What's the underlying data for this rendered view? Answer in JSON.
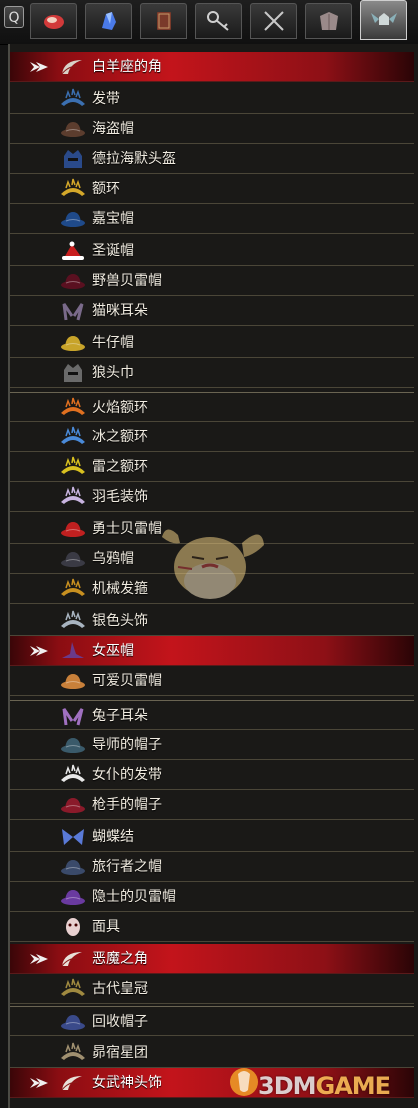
{
  "search": {
    "label": "Q"
  },
  "tabs": [
    {
      "name": "tab-food",
      "icon": "meat-icon"
    },
    {
      "name": "tab-materials",
      "icon": "crystal-icon"
    },
    {
      "name": "tab-books",
      "icon": "book-icon"
    },
    {
      "name": "tab-keys",
      "icon": "key-icon"
    },
    {
      "name": "tab-weapons",
      "icon": "crossed-swords-icon"
    },
    {
      "name": "tab-armor",
      "icon": "armor-icon"
    },
    {
      "name": "tab-accessories",
      "icon": "winged-helmet-icon",
      "active": true
    }
  ],
  "items": [
    {
      "label": "白羊座的角",
      "selected": true,
      "icon": "horn-icon",
      "color": "#d8d2c8"
    },
    {
      "label": "发带",
      "icon": "headband-icon",
      "color": "#3b6fb0"
    },
    {
      "label": "海盗帽",
      "icon": "pirate-hat-icon",
      "color": "#5c3d2e"
    },
    {
      "label": "德拉海默头盔",
      "icon": "helmet-icon",
      "color": "#2a4a8a"
    },
    {
      "label": "额环",
      "icon": "circlet-icon",
      "color": "#d4a82a"
    },
    {
      "label": "嘉宝帽",
      "icon": "cap-icon",
      "color": "#1f4a8a"
    },
    {
      "label": "圣诞帽",
      "icon": "santa-hat-icon",
      "color": "#c81e1e"
    },
    {
      "label": "野兽贝雷帽",
      "icon": "beret-icon",
      "color": "#5a1020"
    },
    {
      "label": "猫咪耳朵",
      "icon": "cat-ears-icon",
      "color": "#7a6a8a"
    },
    {
      "label": "牛仔帽",
      "icon": "cowboy-hat-icon",
      "color": "#c8a42a"
    },
    {
      "label": "狼头巾",
      "icon": "wolf-hood-icon",
      "color": "#6a6a6a"
    },
    {
      "label": "火焰额环",
      "icon": "flame-circlet-icon",
      "color": "#e07020"
    },
    {
      "label": "冰之额环",
      "icon": "ice-circlet-icon",
      "color": "#4a8ad8"
    },
    {
      "label": "雷之额环",
      "icon": "thunder-circlet-icon",
      "color": "#d8c020"
    },
    {
      "label": "羽毛装饰",
      "icon": "feather-icon",
      "color": "#c8b4e0"
    },
    {
      "label": "勇士贝雷帽",
      "icon": "red-beret-icon",
      "color": "#c02020"
    },
    {
      "label": "乌鸦帽",
      "icon": "crow-hat-icon",
      "color": "#3a3a44"
    },
    {
      "label": "机械发箍",
      "icon": "gear-headband-icon",
      "color": "#c89020"
    },
    {
      "label": "银色头饰",
      "icon": "tiara-icon",
      "color": "#a8b4c0"
    },
    {
      "label": "女巫帽",
      "selected": true,
      "icon": "witch-hat-icon",
      "color": "#6a3a8a"
    },
    {
      "label": "可爱贝雷帽",
      "icon": "cute-beret-icon",
      "color": "#c8803a"
    },
    {
      "label": "兔子耳朵",
      "icon": "bunny-ears-icon",
      "color": "#a070c0"
    },
    {
      "label": "导师的帽子",
      "icon": "mentor-hat-icon",
      "color": "#3a5a6a"
    },
    {
      "label": "女仆的发带",
      "icon": "maid-headband-icon",
      "color": "#e8e8e8"
    },
    {
      "label": "枪手的帽子",
      "icon": "gunner-hat-icon",
      "color": "#8a1a2a"
    },
    {
      "label": "蝴蝶结",
      "icon": "bow-icon",
      "color": "#5a7ad8"
    },
    {
      "label": "旅行者之帽",
      "icon": "traveler-hat-icon",
      "color": "#3a4a6a"
    },
    {
      "label": "隐士的贝雷帽",
      "icon": "hermit-beret-icon",
      "color": "#6a3aa0"
    },
    {
      "label": "面具",
      "icon": "mask-icon",
      "color": "#e8d0d0"
    },
    {
      "label": "恶魔之角",
      "selected": true,
      "icon": "demon-horns-icon",
      "color": "#e8e0d8"
    },
    {
      "label": "古代皇冠",
      "icon": "ancient-crown-icon",
      "color": "#a08a40"
    },
    {
      "label": "回收帽子",
      "icon": "recycled-hat-icon",
      "color": "#3a4a8a"
    },
    {
      "label": "昴宿星团",
      "icon": "pleiades-icon",
      "color": "#a09070"
    },
    {
      "label": "女武神头饰",
      "selected": true,
      "icon": "valkyrie-headpiece-icon",
      "color": "#e8e0d8"
    }
  ],
  "watermark": {
    "text_a": "3DM",
    "text_b": "GAME"
  }
}
